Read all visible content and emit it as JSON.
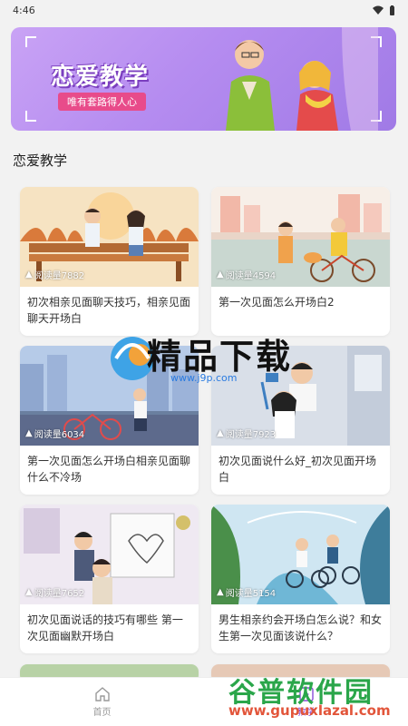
{
  "status": {
    "time": "4:46"
  },
  "banner": {
    "title": "恋爱教学",
    "subtitle": "唯有套路得人心"
  },
  "section": {
    "title": "恋爱教学"
  },
  "articles": [
    {
      "reads": "阅读量7882",
      "title": "初次相亲见面聊天技巧，相亲见面聊天开场白"
    },
    {
      "reads": "阅读量4594",
      "title": "第一次见面怎么开场白2"
    },
    {
      "reads": "阅读量6034",
      "title": "第一次见面怎么开场白相亲见面聊什么不冷场"
    },
    {
      "reads": "阅读量7923",
      "title": "初次见面说什么好_初次见面开场白"
    },
    {
      "reads": "阅读量7652",
      "title": "初次见面说话的技巧有哪些 第一次见面幽默开场白"
    },
    {
      "reads": "阅读量5154",
      "title": "男生相亲约会开场白怎么说？和女生第一次见面该说什么？"
    }
  ],
  "tabs": [
    {
      "label": "首页",
      "icon": "home-icon"
    },
    {
      "label": "教学",
      "icon": "play-book-icon"
    }
  ],
  "watermarks": {
    "jp_text": "精品下载",
    "jp_url": "www.j9p.com",
    "gp_text": "谷普软件园",
    "gp_url": "www.gupuxlazal.com"
  },
  "colors": {
    "accent": "#8a4bd8",
    "banner_bg": "#b58cf0",
    "subtitle_bg": "#e84b8a"
  }
}
